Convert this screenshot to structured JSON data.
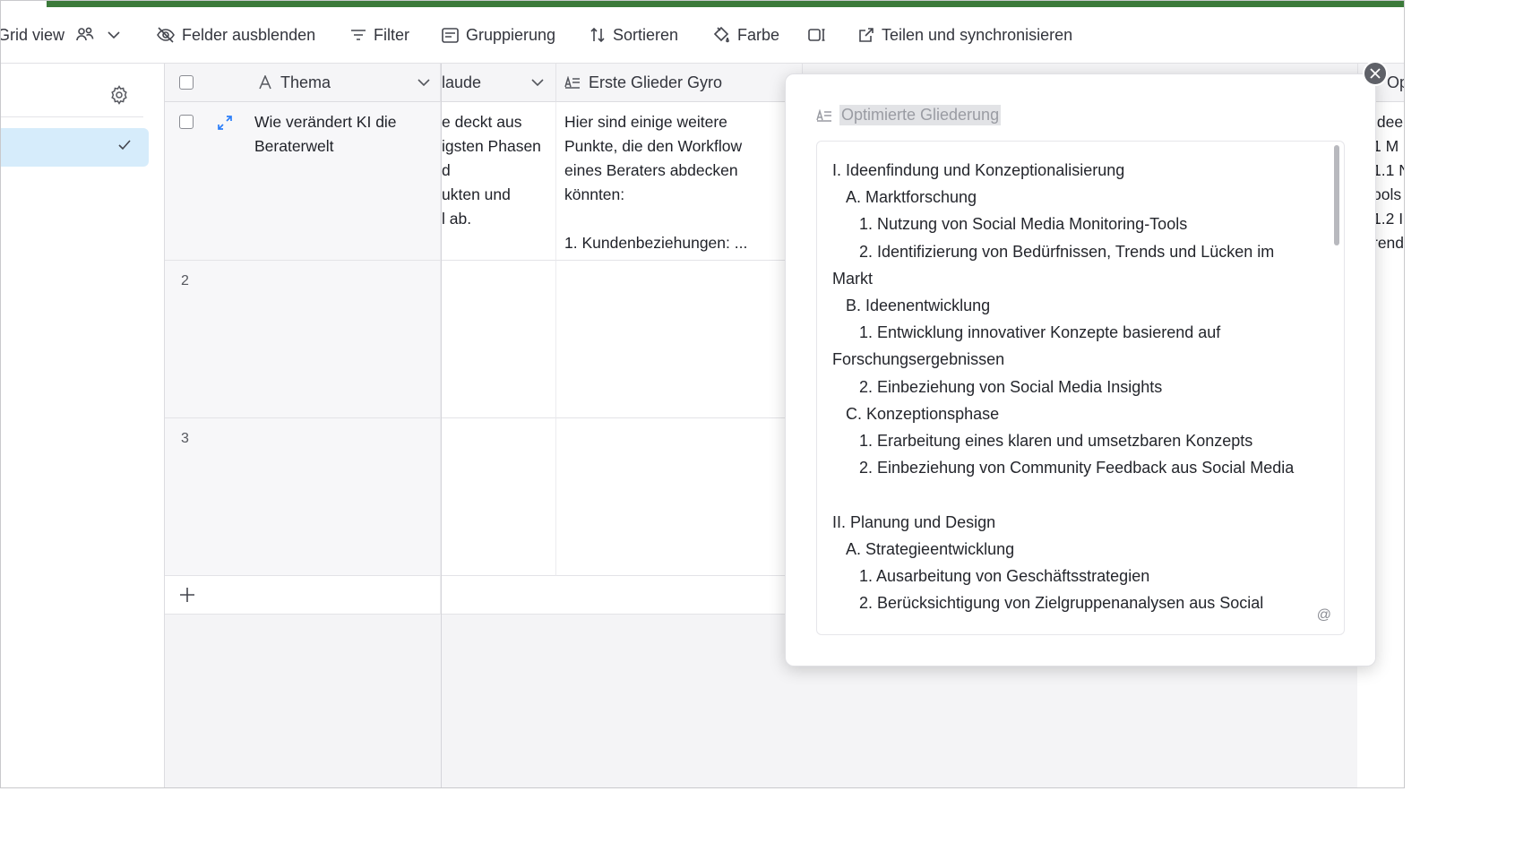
{
  "toolbar": {
    "view_name": "Grid view",
    "hide_fields": "Felder ausblenden",
    "filter": "Filter",
    "group": "Gruppierung",
    "sort": "Sortieren",
    "color": "Farbe",
    "share": "Teilen und synchronisieren"
  },
  "grid": {
    "columns": {
      "thema": "Thema",
      "claude": "laude",
      "gyro": "Erste Glieder Gyro"
    },
    "rows": [
      {
        "number": "",
        "thema": "Wie verändert KI die Beraterwelt",
        "claude": "e deckt aus\nigsten Phasen\nd\nukten und\nl ab.",
        "gyro": "Hier sind einige weitere Punkte, die den Workflow eines Beraters abdecken könnten:\n\n1. Kundenbeziehungen: ..."
      },
      {
        "number": "2",
        "thema": "",
        "claude": "",
        "gyro": ""
      },
      {
        "number": "3",
        "thema": "",
        "claude": "",
        "gyro": ""
      }
    ],
    "add_row_icon": "plus-icon"
  },
  "right_column": {
    "header": "Op",
    "text": "Idee\n1 M\n1.1 N\nools\n1.2 I\nrend"
  },
  "panel": {
    "field_label": "Optimierte Gliederung",
    "content": "I. Ideenfindung und Konzeptionalisierung\n   A. Marktforschung\n      1. Nutzung von Social Media Monitoring-Tools\n      2. Identifizierung von Bedürfnissen, Trends und Lücken im Markt\n   B. Ideenentwicklung\n      1. Entwicklung innovativer Konzepte basierend auf Forschungsergebnissen\n      2. Einbeziehung von Social Media Insights\n   C. Konzeptionsphase\n      1. Erarbeitung eines klaren und umsetzbaren Konzepts\n      2. Einbeziehung von Community Feedback aus Social Media\n\nII. Planung und Design\n   A. Strategieentwicklung\n      1. Ausarbeitung von Geschäftsstrategien\n      2. Berücksichtigung von Zielgruppenanalysen aus Social",
    "at_icon": "@"
  },
  "colors": {
    "accent_bar": "#3b7a3a",
    "selected_view": "#d6ecfb",
    "expand_icon": "#2d7ff9"
  }
}
